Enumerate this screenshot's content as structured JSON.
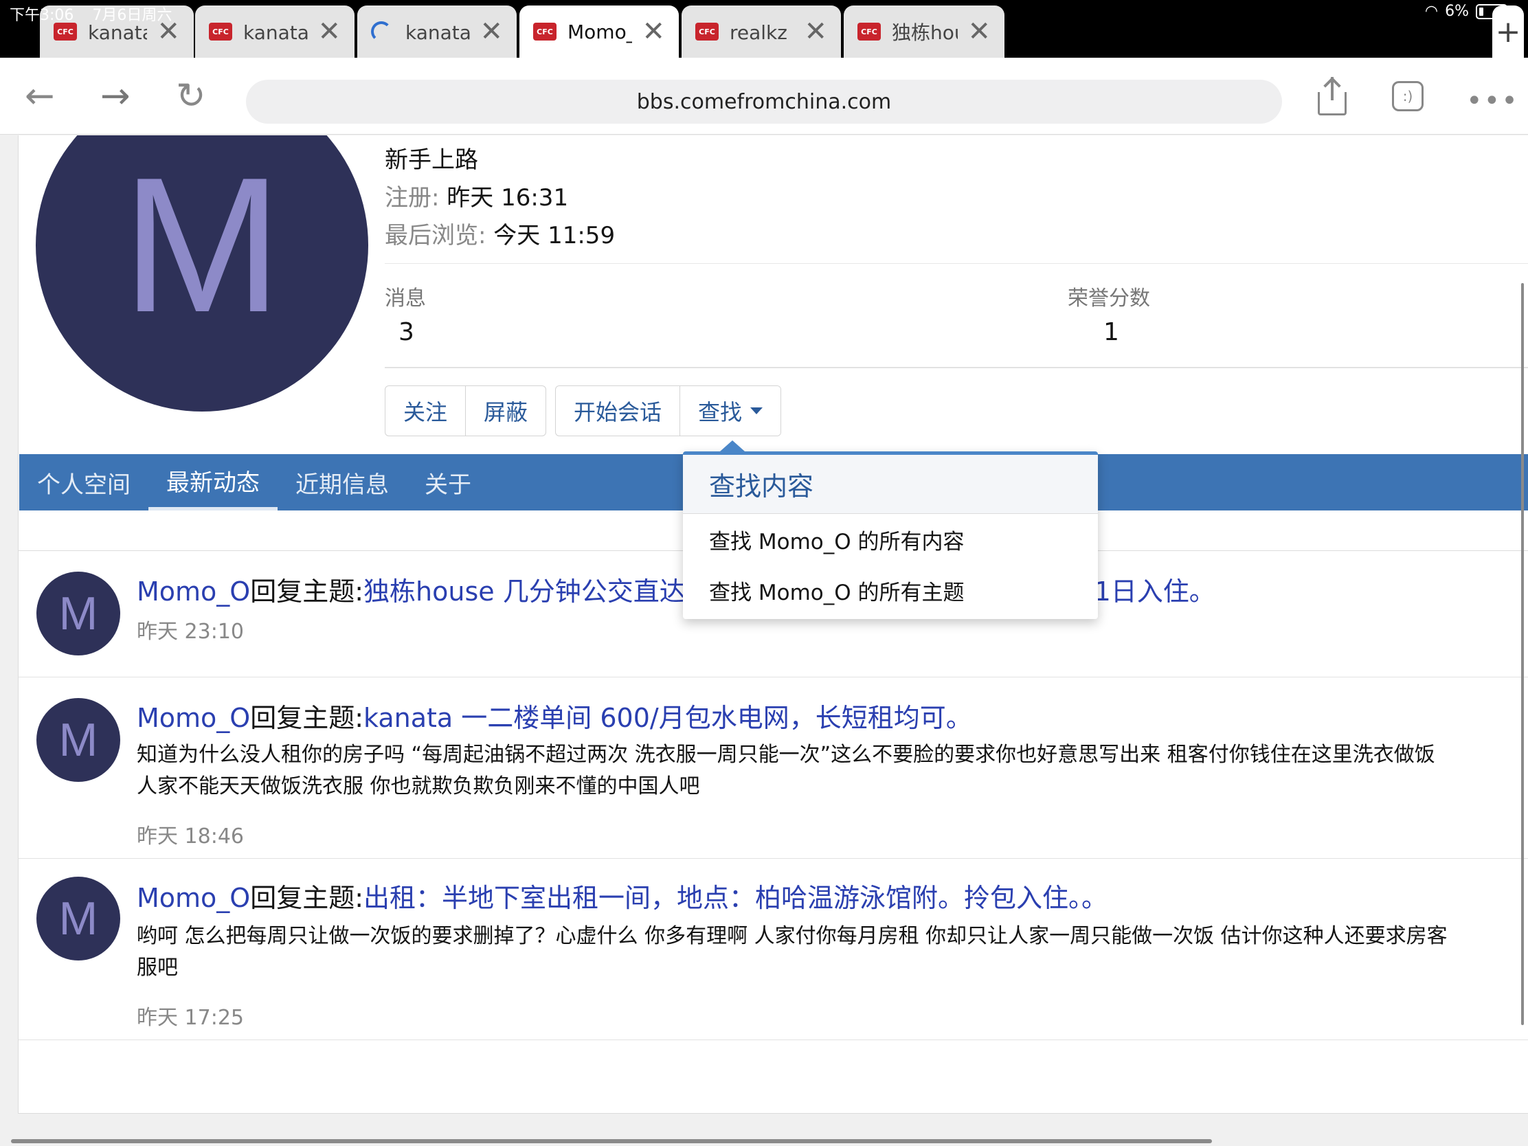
{
  "status": {
    "time": "下午3:06",
    "date": "7月6日周六",
    "battery": "6%"
  },
  "tabs": [
    {
      "label": "kanata北 半地下",
      "close": "✕",
      "fav": "CFC"
    },
    {
      "label": "kanata北湖景房",
      "close": "✕",
      "fav": "CFC"
    },
    {
      "label": "kanata 一二楼单",
      "close": "✕",
      "fav": ""
    },
    {
      "label": "Momo_O | CFC",
      "close": "✕",
      "fav": "CFC"
    },
    {
      "label": "realkz | CFC中文",
      "close": "✕",
      "fav": "CFC"
    },
    {
      "label": "独栋house 几分",
      "close": "✕",
      "fav": "CFC"
    }
  ],
  "new_tab": "+",
  "toolbar": {
    "back": "←",
    "forward": "→",
    "reload": "↻",
    "url": "bbs.comefromchina.com",
    "reader": ":)",
    "more": "•••"
  },
  "profile": {
    "avatar_letter": "M",
    "rank": "新手上路",
    "registered_label": "注册:",
    "registered_value": "昨天 16:31",
    "last_seen_label": "最后浏览:",
    "last_seen_value": "今天 11:59",
    "messages_label": "消息",
    "messages_value": "3",
    "honor_label": "荣誉分数",
    "honor_value": "1"
  },
  "buttons": {
    "follow": "关注",
    "block": "屏蔽",
    "start_conversation": "开始会话",
    "find": "查找"
  },
  "nav": {
    "items": [
      "个人空间",
      "最新动态",
      "近期信息",
      "关于"
    ],
    "selected": 1
  },
  "dropdown": {
    "title": "查找内容",
    "items": [
      "查找 Momo_O 的所有内容",
      "查找 Momo_O 的所有主题"
    ]
  },
  "feed": [
    {
      "avatar": "M",
      "user": "Momo_O",
      "action": "回复主题:",
      "thread": "独栋house 几分钟公交直达Algonquin学院- 水电暖网全包 9月1日入住。",
      "body": "",
      "time": "昨天 23:10"
    },
    {
      "avatar": "M",
      "user": "Momo_O",
      "action": "回复主题:",
      "thread": "kanata 一二楼单间 600/月包水电网，长短租均可。",
      "body_lines": [
        "知道为什么没人租你的房子吗 “每周起油锅不超过两次 洗衣服一周只能一次”这么不要脸的要求你也好意思写出来 租客付你钱住在这里洗衣做饭",
        "人家不能天天做饭洗衣服 你也就欺负欺负刚来不懂的中国人吧"
      ],
      "time": "昨天 18:46"
    },
    {
      "avatar": "M",
      "user": "Momo_O",
      "action": "回复主题:",
      "thread": "出租：半地下室出租一间，地点：柏哈温游泳馆附。拎包入住。。",
      "body_lines": [
        "哟呵 怎么把每周只让做一次饭的要求删掉了？心虚什么 你多有理啊 人家付你每月房租 你却只让人家一周只能做一次饭 估计你这种人还要求房客",
        "服吧"
      ],
      "time": "昨天 17:25"
    }
  ]
}
